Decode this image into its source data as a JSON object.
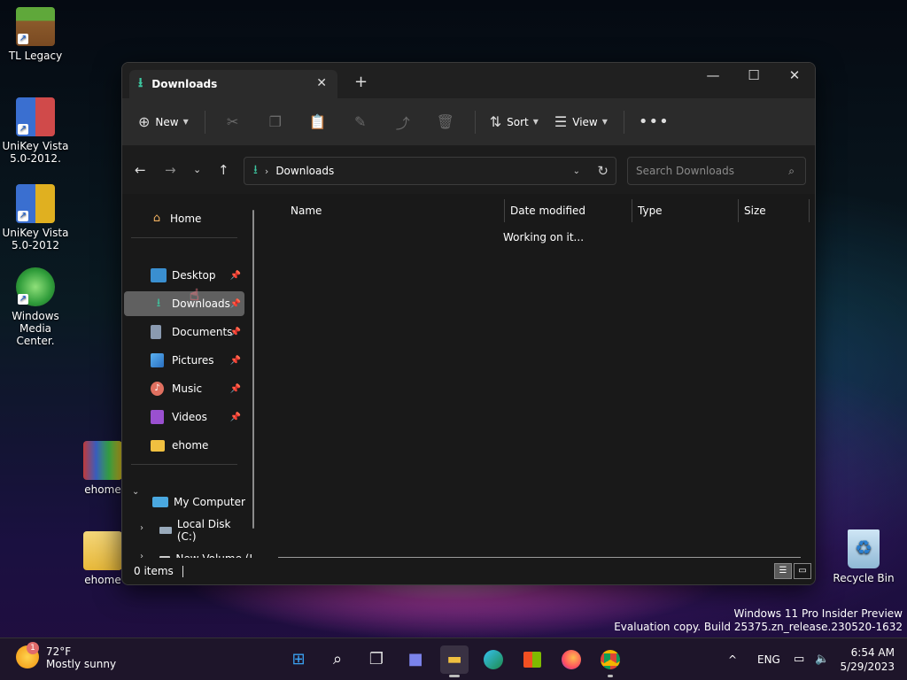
{
  "desktop": {
    "icons": [
      {
        "label": "TL Legacy"
      },
      {
        "label": "UniKey Vista 5.0-2012."
      },
      {
        "label": "UniKey Vista 5.0-2012"
      },
      {
        "label": "Windows Media Center."
      },
      {
        "label": "ehome"
      },
      {
        "label": "ehome"
      },
      {
        "label": "Recycle Bin"
      }
    ]
  },
  "explorer": {
    "tab_title": "Downloads",
    "toolbar": {
      "new_label": "New",
      "sort_label": "Sort",
      "view_label": "View"
    },
    "address": {
      "path": "Downloads"
    },
    "search": {
      "placeholder": "Search Downloads"
    },
    "sidebar": {
      "home": "Home",
      "quick_access": [
        {
          "label": "Desktop",
          "icon": "desktop-icon"
        },
        {
          "label": "Downloads",
          "icon": "download-icon"
        },
        {
          "label": "Documents",
          "icon": "document-icon"
        },
        {
          "label": "Pictures",
          "icon": "pictures-icon"
        },
        {
          "label": "Music",
          "icon": "music-icon"
        },
        {
          "label": "Videos",
          "icon": "video-icon"
        },
        {
          "label": "ehome",
          "icon": "folder-icon"
        }
      ],
      "computer": "My Computer",
      "drives": [
        {
          "label": "Local Disk (C:)"
        },
        {
          "label": "New Volume (I"
        }
      ]
    },
    "columns": [
      "Name",
      "Date modified",
      "Type",
      "Size"
    ],
    "status_message": "Working on it...",
    "status_bar": "0 items"
  },
  "watermark": {
    "line1": "Windows 11 Pro Insider Preview",
    "line2": "Evaluation copy. Build 25375.zn_release.230520-1632"
  },
  "taskbar": {
    "weather": {
      "temp": "72°F",
      "condition": "Mostly sunny",
      "badge": "1"
    },
    "language": "ENG",
    "time": "6:54 AM",
    "date": "5/29/2023"
  }
}
